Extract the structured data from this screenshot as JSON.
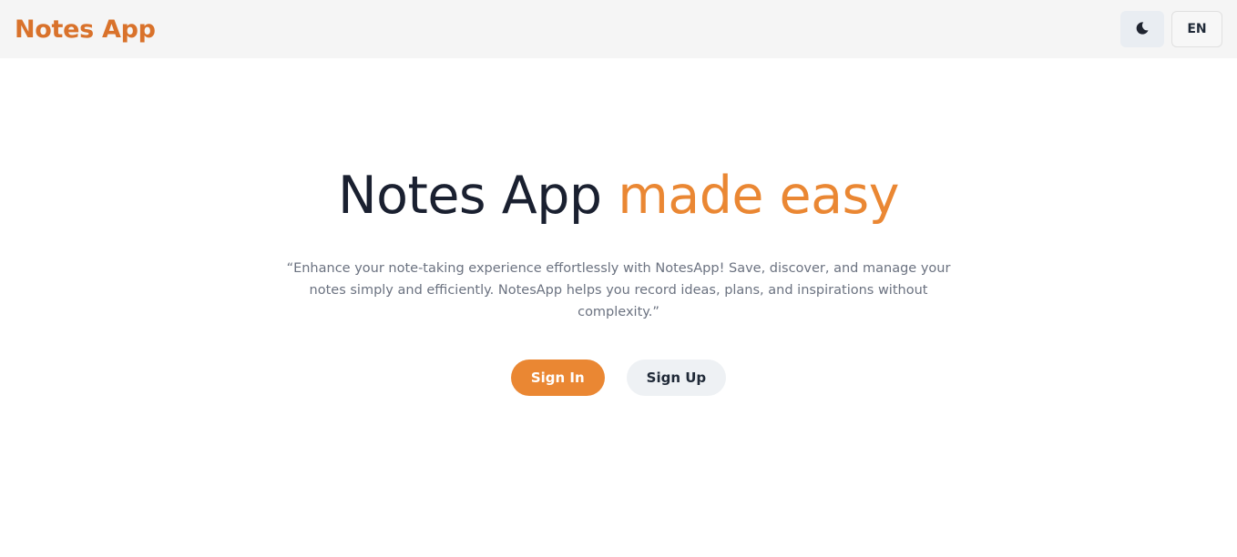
{
  "navbar": {
    "brand": "Notes App",
    "theme_toggle_icon": "moon-icon",
    "language_label": "EN"
  },
  "hero": {
    "title_main": "Notes App",
    "title_accent": "made easy",
    "description": "“Enhance your note-taking experience effortlessly with NotesApp! Save, discover, and manage your notes simply and efficiently. NotesApp helps you record ideas, plans, and inspirations without complexity.”",
    "sign_in_label": "Sign In",
    "sign_up_label": "Sign Up"
  },
  "colors": {
    "brand": "#d9722b",
    "accent": "#ea8733",
    "heading": "#1a2030",
    "muted_text": "#6b7280",
    "navbar_bg": "#f5f5f5"
  }
}
